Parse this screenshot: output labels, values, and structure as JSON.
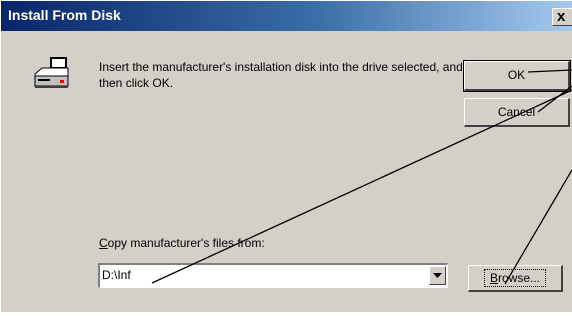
{
  "window": {
    "title": "Install From Disk",
    "close_glyph": "x"
  },
  "message": {
    "text": "Insert the manufacturer's installation disk into the drive selected, and then click OK."
  },
  "buttons": {
    "ok": "OK",
    "cancel": "Cancel",
    "browse_prefix": "B",
    "browse_rest": "rowse..."
  },
  "copy_from": {
    "label_prefix": "C",
    "label_rest": "opy manufacturer's files from:",
    "value": "D:\\Inf"
  },
  "icons": {
    "disk": "floppy-drive-icon",
    "dropdown": "chevron-down-icon"
  },
  "colors": {
    "title_start": "#0a246a",
    "title_end": "#a6caf0",
    "face": "#d4d0c8"
  }
}
